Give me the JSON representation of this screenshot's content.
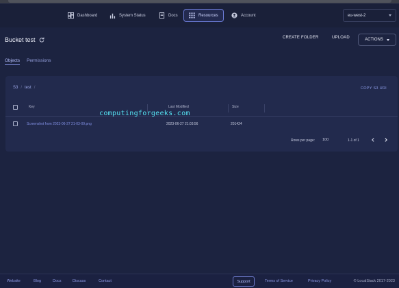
{
  "nav": {
    "items": [
      {
        "label": "Dashboard",
        "icon": "dashboard-icon"
      },
      {
        "label": "System Status",
        "icon": "bar-chart-icon"
      },
      {
        "label": "Docs",
        "icon": "document-icon"
      },
      {
        "label": "Resources",
        "icon": "grid-icon",
        "active": true
      },
      {
        "label": "Account",
        "icon": "account-icon"
      }
    ],
    "region": "eu-west-2"
  },
  "header": {
    "title": "Bucket test",
    "create_folder": "CREATE FOLDER",
    "upload": "UPLOAD",
    "actions": "ACTIONS"
  },
  "tabs": [
    "Objects",
    "Permissions"
  ],
  "breadcrumb": [
    "S3",
    "test"
  ],
  "copy_uri": "COPY S3 URI",
  "table": {
    "headers": {
      "key": "Key",
      "last_modified": "Last Modified",
      "size": "Size"
    },
    "rows": [
      {
        "key": "Screenshot from 2023-06-27 21-03-09.png",
        "last_modified": "2023-06-27 21:03:56",
        "size": "201424"
      }
    ]
  },
  "pagination": {
    "rows_per_page_label": "Rows per page:",
    "rows_per_page": "100",
    "range": "1-1 of 1"
  },
  "watermark": "computingforgeeks.com",
  "footer": {
    "links": [
      "Website",
      "Blog",
      "Docs",
      "Discuss",
      "Contact"
    ],
    "support": "Support",
    "terms": "Terms of Service",
    "privacy": "Privacy Policy",
    "copyright": "© LocalStack 2017-2023"
  },
  "colors": {
    "accent": "#8c9aef",
    "background": "#1c2340",
    "panel": "#222a4d",
    "watermark": "#55e0f0"
  }
}
